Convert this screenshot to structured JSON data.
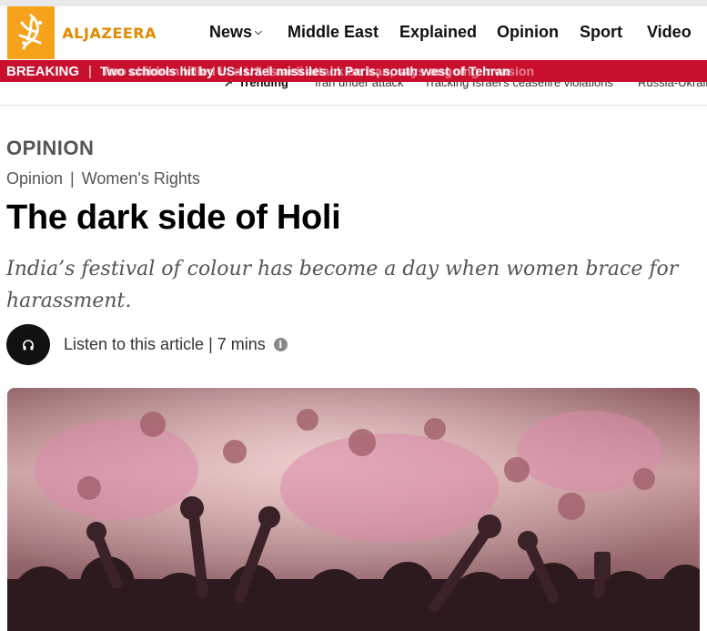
{
  "brand": {
    "name": "ALJAZEERA",
    "logo_color": "#f6a21b",
    "accent": "#c8102e"
  },
  "nav": {
    "items": [
      {
        "label": "News",
        "has_dropdown": true
      },
      {
        "label": "Middle East"
      },
      {
        "label": "Explained"
      },
      {
        "label": "Opinion"
      },
      {
        "label": "Sport"
      },
      {
        "label": "Video"
      }
    ]
  },
  "breaking": {
    "label": "BREAKING",
    "headline": "Two schools hit by US-Israel missiles in Paris, south west of Tehran",
    "ghost_headline": "Two children killed in a US-Israeli attack on Iran, says ongoing invasion"
  },
  "trending": {
    "title": "Trending",
    "items": [
      "Iran under attack",
      "Tracking Israel's ceasefire violations",
      "Russia-Ukraine war"
    ]
  },
  "article": {
    "section": "OPINION",
    "breadcrumb": [
      "Opinion",
      "Women's Rights"
    ],
    "title": "The dark side of Holi",
    "subtitle": "India’s festival of colour has become a day when women brace for harassment.",
    "listen_label": "Listen to this article | 7 mins"
  }
}
